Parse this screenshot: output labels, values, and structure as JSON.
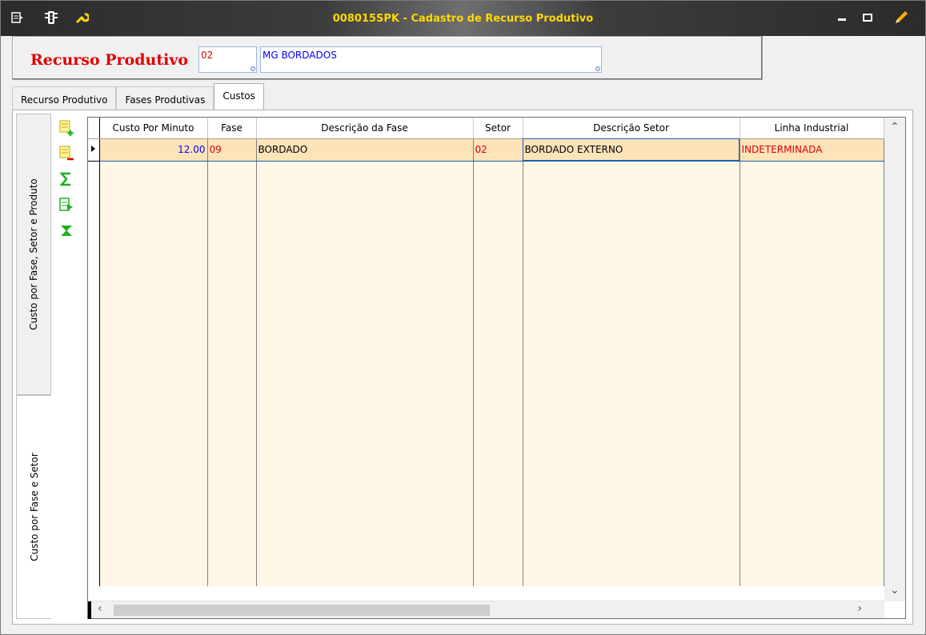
{
  "window": {
    "title": "008015SPK - Cadastro de Recurso Produtivo"
  },
  "header": {
    "label": "Recurso Produtivo",
    "code": "02",
    "name": "MG BORDADOS"
  },
  "tabs": [
    {
      "label": "Recurso Produtivo",
      "active": false
    },
    {
      "label": "Fases Produtivas",
      "active": false
    },
    {
      "label": "Custos",
      "active": true
    }
  ],
  "side_tabs": [
    {
      "label": "Custo por Fase, Setor e Produto"
    },
    {
      "label": "Custo por Fase e Setor"
    }
  ],
  "toolbar": [
    "add-row-icon",
    "remove-row-icon",
    "sum-icon",
    "export-icon",
    "filter-icon"
  ],
  "grid": {
    "columns": [
      "Custo Por Minuto",
      "Fase",
      "Descrição da Fase",
      "Setor",
      "Descrição Setor",
      "Linha Industrial"
    ],
    "rows": [
      [
        "12.00",
        "09",
        "BORDADO",
        "02",
        "BORDADO EXTERNO",
        "INDETERMINADA"
      ]
    ]
  },
  "colors": {
    "title": "#ffd800",
    "accent_red": "#e00000",
    "value_blue": "#0000ff",
    "selected_row": "#fde3b8"
  }
}
